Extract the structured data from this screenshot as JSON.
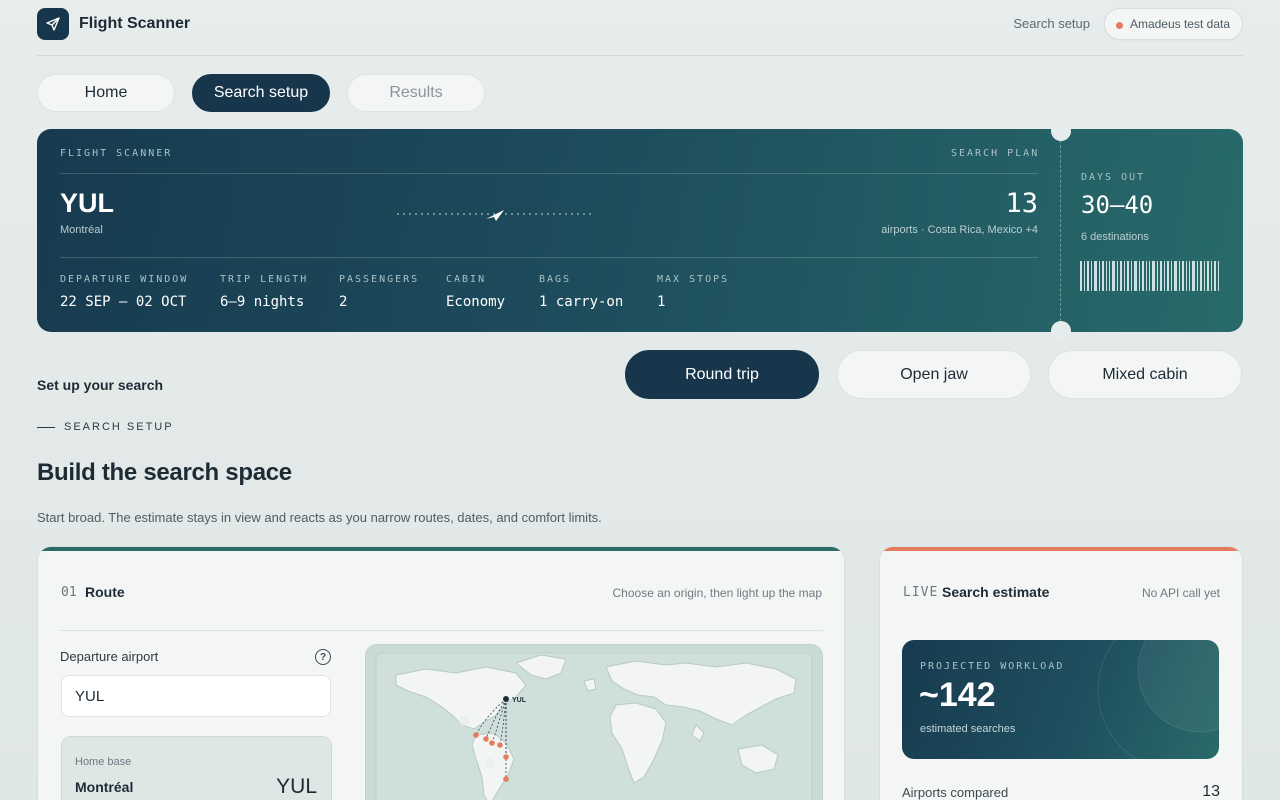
{
  "app": {
    "name": "Flight Scanner",
    "top_link": "Search setup",
    "data_source": "Amadeus test data"
  },
  "nav": {
    "tabs": [
      {
        "label": "Home"
      },
      {
        "label": "Search setup"
      },
      {
        "label": "Results"
      }
    ],
    "active": "Search setup"
  },
  "ticket": {
    "brand": "FLIGHT SCANNER",
    "plan_label": "SEARCH PLAN",
    "origin_code": "YUL",
    "origin_city": "Montréal",
    "airport_count": "13",
    "airport_desc": "airports · Costa Rica, Mexico +4",
    "days_out_label": "DAYS OUT",
    "days_out_value": "30–40",
    "destinations": "6 destinations",
    "fields": [
      {
        "label": "DEPARTURE WINDOW",
        "value": "22 SEP – 02 OCT"
      },
      {
        "label": "TRIP LENGTH",
        "value": "6–9 nights"
      },
      {
        "label": "PASSENGERS",
        "value": "2"
      },
      {
        "label": "CABIN",
        "value": "Economy"
      },
      {
        "label": "BAGS",
        "value": "1 carry-on"
      },
      {
        "label": "MAX STOPS",
        "value": "1"
      }
    ]
  },
  "trip_types": {
    "options": [
      "Round trip",
      "Open jaw",
      "Mixed cabin"
    ],
    "selected": "Round trip"
  },
  "setup": {
    "title": "Set up your search",
    "eyebrow": "SEARCH SETUP",
    "heading": "Build the search space",
    "lede": "Start broad. The estimate stays in view and reacts as you narrow routes, dates, and comfort limits."
  },
  "route_card": {
    "number": "01",
    "title": "Route",
    "hint": "Choose an origin, then light up the map",
    "departure_label": "Departure airport",
    "departure_value": "YUL",
    "home_base_label": "Home base",
    "home_base_city": "Montréal",
    "home_base_code": "YUL",
    "map_origin_label": "YUL"
  },
  "estimate_card": {
    "live": "LIVE",
    "title": "Search estimate",
    "status": "No API call yet",
    "workload_label": "PROJECTED WORKLOAD",
    "workload_value": "~142",
    "workload_unit": "estimated searches",
    "rows": [
      {
        "label": "Airports compared",
        "value": "13"
      }
    ]
  },
  "colors": {
    "navy": "#17364b",
    "teal": "#2a6a69",
    "coral": "#e57b5f",
    "route_accent": "#2c6b6a"
  },
  "icons": {
    "logo": "paper-plane-icon",
    "help": "question-circle-icon",
    "plane": "plane-icon",
    "live_dot": "status-dot-icon"
  }
}
